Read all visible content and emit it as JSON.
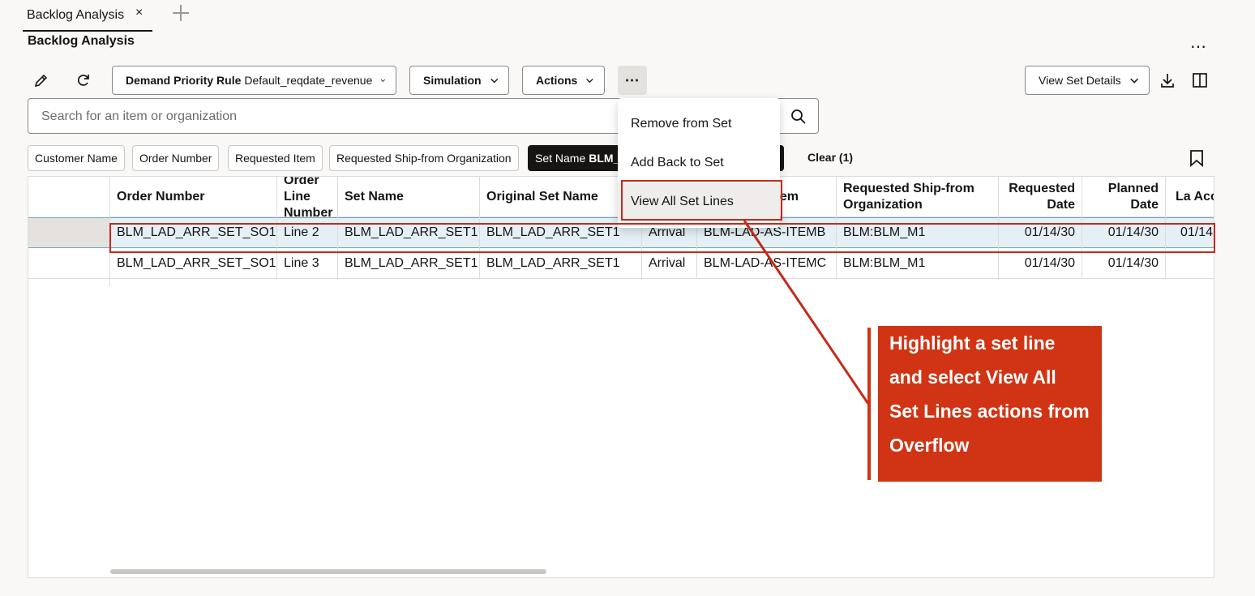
{
  "tabs": {
    "active_label": "Backlog Analysis",
    "close_glyph": "×"
  },
  "page": {
    "title": "Backlog Analysis",
    "more_glyph": "⋯"
  },
  "toolbar": {
    "demand_priority_label": "Demand Priority Rule",
    "demand_priority_value": "Default_reqdate_revenue",
    "simulation_label": "Simulation",
    "actions_label": "Actions",
    "overflow_glyph": "⋯",
    "view_set_details_label": "View Set Details"
  },
  "search": {
    "placeholder": "Search for an item or organization"
  },
  "filters": {
    "chips": [
      "Customer Name",
      "Order Number",
      "Requested Item",
      "Requested Ship-from Organization"
    ],
    "active_chip_label": "Set Name",
    "active_chip_value": "BLM_",
    "clear_label": "Clear (1)"
  },
  "table": {
    "headers": {
      "order_number": "Order Number",
      "order_line_number": "Order Line Number",
      "set_name": "Set Name",
      "original_set_name": "Original Set Name",
      "requested_item": "em",
      "requested_ship_from": "Requested Ship-from Organization",
      "requested_date": "Requested Date",
      "planned_date": "Planned Date",
      "latest_acceptable": "La Accept"
    },
    "rows": [
      {
        "order_number": "BLM_LAD_ARR_SET_SO1",
        "line": "Line 2",
        "set_name": "BLM_LAD_ARR_SET1",
        "original_set_name": "BLM_LAD_ARR_SET1",
        "type": "Arrival",
        "item": "BLM-LAD-AS-ITEMB",
        "org": "BLM:BLM_M1",
        "requested_date": "01/14/30",
        "planned_date": "01/14/30",
        "latest": "01/14"
      },
      {
        "order_number": "BLM_LAD_ARR_SET_SO1",
        "line": "Line 3",
        "set_name": "BLM_LAD_ARR_SET1",
        "original_set_name": "BLM_LAD_ARR_SET1",
        "type": "Arrival",
        "item": "BLM-LAD-AS-ITEMC",
        "org": "BLM:BLM_M1",
        "requested_date": "01/14/30",
        "planned_date": "01/14/30",
        "latest": ""
      }
    ]
  },
  "overflow_menu": {
    "items": [
      "Remove from Set",
      "Add Back to Set",
      "View All Set Lines"
    ]
  },
  "callout": {
    "text": "Highlight a set line\nand select View All\nSet Lines actions from\nOverflow"
  },
  "colors": {
    "annotation_red": "#c52a1a",
    "callout_bg": "#d13414",
    "selected_row": "#e4f0f5"
  }
}
